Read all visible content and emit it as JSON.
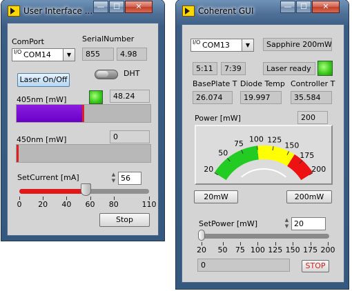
{
  "left_window": {
    "title": "User Interface ...",
    "controls": {
      "minimize": "—",
      "maximize": "☐",
      "close": "✕"
    },
    "comport_label": "ComPort",
    "comport_io": "I/O",
    "comport_value": "COM14",
    "serial_label": "SerialNumber",
    "serial_value_1": "855",
    "serial_value_2": "4.98",
    "laser_button": "Laser On/Off",
    "dht_label": "DHT",
    "nm405_label": "405nm [mW]",
    "nm405_value": "48.24",
    "nm405_level": 0.49,
    "nm450_label": "450nm [mW]",
    "nm450_value": "0",
    "nm450_level": 0.0,
    "setcurrent_label": "SetCurrent [mA]",
    "setcurrent_value": "56",
    "setcurrent_slider": 56,
    "slider_ticks": [
      "0",
      "20",
      "40",
      "60",
      "80",
      "110"
    ],
    "stop_button": "Stop"
  },
  "right_window": {
    "title": "Coherent GUI",
    "controls": {
      "minimize": "—",
      "maximize": "☐",
      "close": "✕"
    },
    "com_io": "I/O",
    "com_value": "COM13",
    "model_value": "Sapphire 200mW",
    "time_1": "5:11",
    "time_2": "7:39",
    "status_text": "Laser ready",
    "baseplate_label": "BasePlate T",
    "baseplate_value": "26.074",
    "diode_label": "Diode Temp",
    "diode_value": "19.997",
    "controller_label": "Controller T",
    "controller_value": "35.584",
    "power_label": "Power [mW]",
    "power_value": "200",
    "gauge_ticks": [
      "20",
      "50",
      "75",
      "100",
      "125",
      "150",
      "175",
      "200"
    ],
    "gauge_colors": {
      "green": "#22cc22",
      "yellow": "#ffff00",
      "red": "#ee1111"
    },
    "btn_20": "20mW",
    "btn_200": "200mW",
    "setpower_label": "SetPower [mW]",
    "setpower_value": "20",
    "setpower_slider": 20,
    "setpower_ticks": [
      "20",
      "50",
      "75",
      "100",
      "125",
      "150",
      "175",
      "200"
    ],
    "bottom_value": "0",
    "stop_button": "STOP"
  }
}
